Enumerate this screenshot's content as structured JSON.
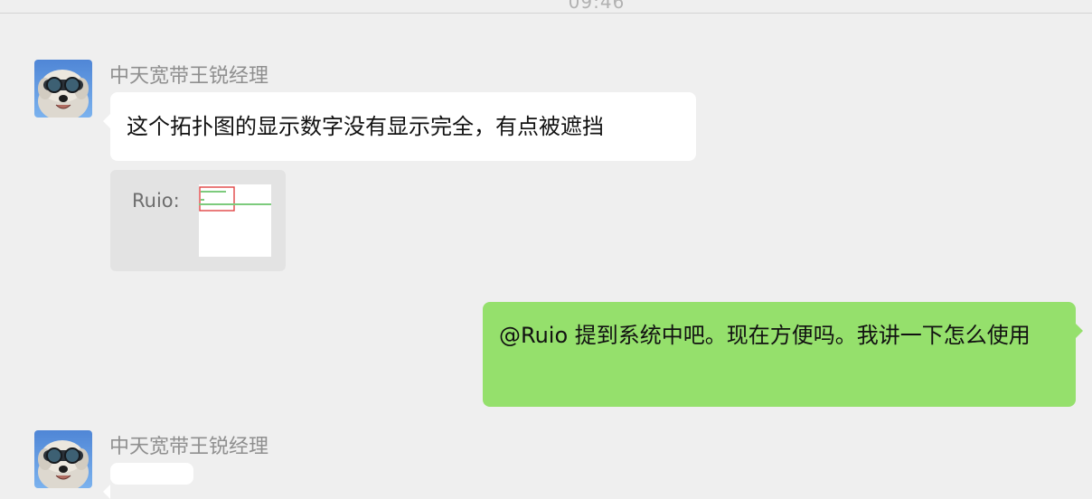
{
  "chat": {
    "timestamp": "09:46",
    "messages": [
      {
        "sender": "中天宽带王锐经理",
        "text": "这个拓扑图的显示数字没有显示完全，有点被遮挡",
        "quote_name": "Ruio:"
      },
      {
        "text": "@Ruio 提到系统中吧。现在方便吗。我讲一下怎么使用"
      },
      {
        "sender": "中天宽带王锐经理"
      }
    ]
  },
  "colors": {
    "background": "#efefef",
    "incoming_bubble": "#ffffff",
    "outgoing_bubble": "#95e06c",
    "sender_name": "#8f8f8f",
    "quote_card": "#e3e3e3"
  },
  "icons": {
    "avatar": "dog-with-goggles-avatar",
    "thumbnail": "topology-screenshot-thumbnail"
  }
}
